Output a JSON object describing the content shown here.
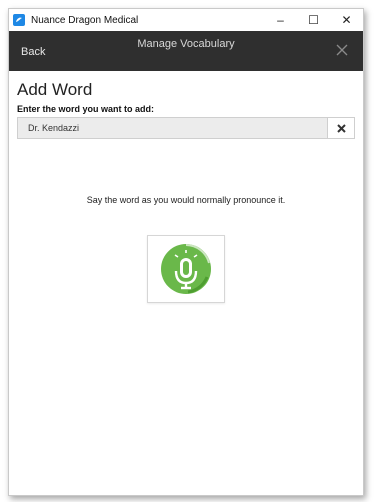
{
  "window": {
    "title": "Nuance Dragon Medical",
    "controls": [
      "–",
      "☐",
      "✕"
    ]
  },
  "navbar": {
    "back_label": "Back",
    "title": "Manage Vocabulary"
  },
  "main": {
    "heading": "Add Word",
    "field_label": "Enter the word you want to add:",
    "word_value": "Dr. Kendazzi",
    "instruction": "Say the word as you would normally pronounce it."
  },
  "colors": {
    "nav_bg": "#2f2f2f",
    "mic_green": "#6ab84a",
    "app_icon_blue": "#1e88e5"
  },
  "icons": {
    "app": "dragon-app-icon",
    "close": "close-icon",
    "clear": "clear-x-icon",
    "mic": "microphone-icon"
  }
}
